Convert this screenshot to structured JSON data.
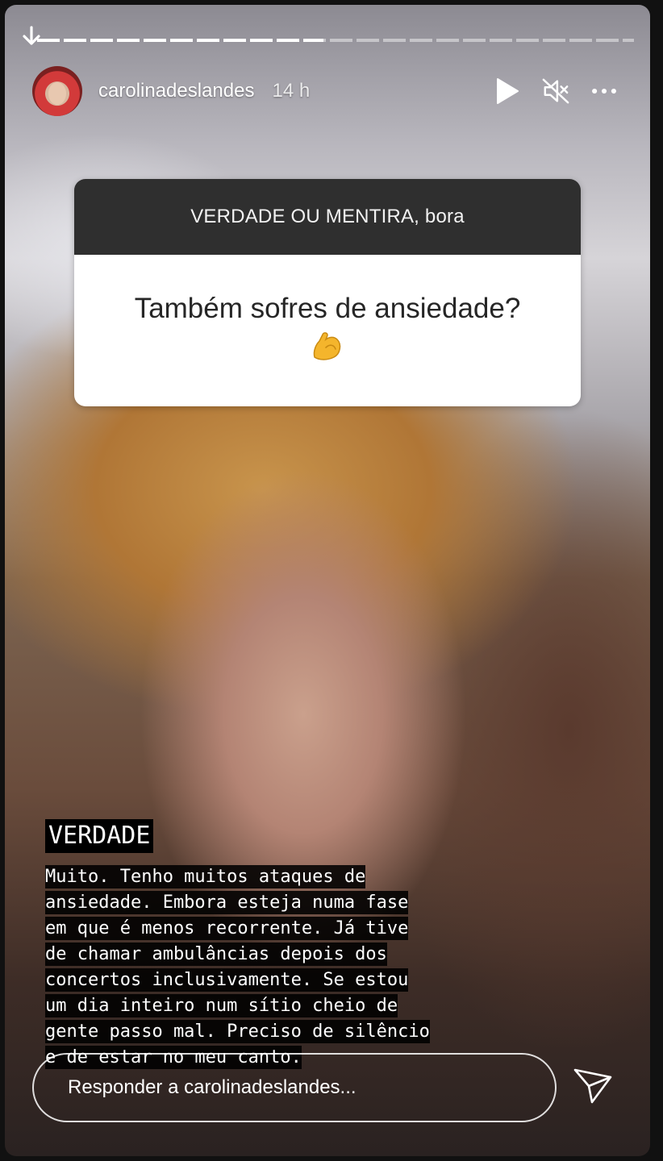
{
  "story": {
    "progress_fraction": 0.48,
    "segments": 22
  },
  "header": {
    "username": "carolinadeslandes",
    "time_ago": "14 h",
    "avatar_icon": "avatar",
    "controls": [
      "play-icon",
      "muted-speaker-icon",
      "more-options-icon"
    ]
  },
  "question_sticker": {
    "prompt": "VERDADE OU MENTIRA, bora",
    "question": "Também sofres de ansiedade?",
    "emoji": "💪"
  },
  "answer": {
    "title": "VERDADE",
    "text": "Muito. Tenho muitos ataques de ansiedade. Embora esteja numa fase em que é menos recorrente. Já tive de chamar ambulâncias depois dos concertos inclusivamente. Se estou um dia inteiro num sítio cheio de gente passo mal. Preciso de silêncio e de estar no meu canto."
  },
  "reply": {
    "placeholder": "Responder a carolinadeslandes..."
  },
  "colors": {
    "sticker_header": "#2f2f2f",
    "sticker_body": "#ffffff",
    "text_background": "#000000"
  }
}
